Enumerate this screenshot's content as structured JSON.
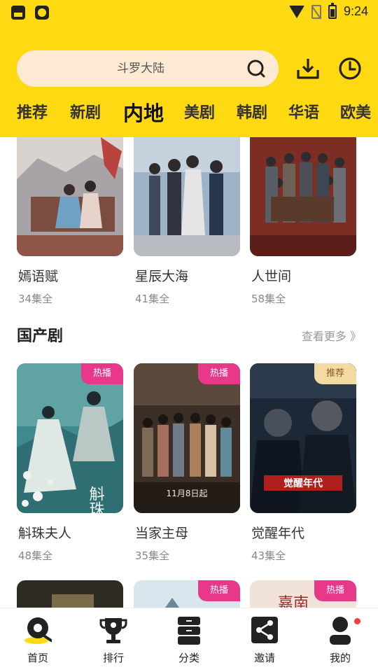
{
  "status_bar": {
    "time": "9:24"
  },
  "search": {
    "placeholder": "斗罗大陆"
  },
  "tabs": [
    {
      "label": "推荐",
      "active": false
    },
    {
      "label": "新剧",
      "active": false
    },
    {
      "label": "内地",
      "active": true
    },
    {
      "label": "美剧",
      "active": false
    },
    {
      "label": "韩剧",
      "active": false
    },
    {
      "label": "华语",
      "active": false
    },
    {
      "label": "欧美",
      "active": false
    }
  ],
  "row_top": [
    {
      "title": "嫣语赋",
      "episodes": "34集全"
    },
    {
      "title": "星辰大海",
      "episodes": "41集全"
    },
    {
      "title": "人世间",
      "episodes": "58集全"
    }
  ],
  "section": {
    "title": "国产剧",
    "more": "查看更多 》"
  },
  "row_mid": [
    {
      "title": "斛珠夫人",
      "episodes": "48集全",
      "badge": "热播",
      "poster_text": "斛珠夫人"
    },
    {
      "title": "当家主母",
      "episodes": "35集全",
      "badge": "热播",
      "poster_text": "11月8日起"
    },
    {
      "title": "觉醒年代",
      "episodes": "43集全",
      "badge": "推荐",
      "poster_text": "觉醒年代"
    }
  ],
  "row_bottom": [
    {
      "badge": ""
    },
    {
      "badge": "热播"
    },
    {
      "badge": "热播",
      "poster_text": "嘉南"
    }
  ],
  "bottom_nav": [
    {
      "label": "首页",
      "icon": "home-reel-icon"
    },
    {
      "label": "排行",
      "icon": "trophy-icon"
    },
    {
      "label": "分类",
      "icon": "category-icon"
    },
    {
      "label": "邀请",
      "icon": "share-icon"
    },
    {
      "label": "我的",
      "icon": "profile-icon"
    }
  ],
  "colors": {
    "accent": "#FFD912",
    "hot_badge": "#E8388A",
    "search_bg": "#FEEAD3"
  }
}
